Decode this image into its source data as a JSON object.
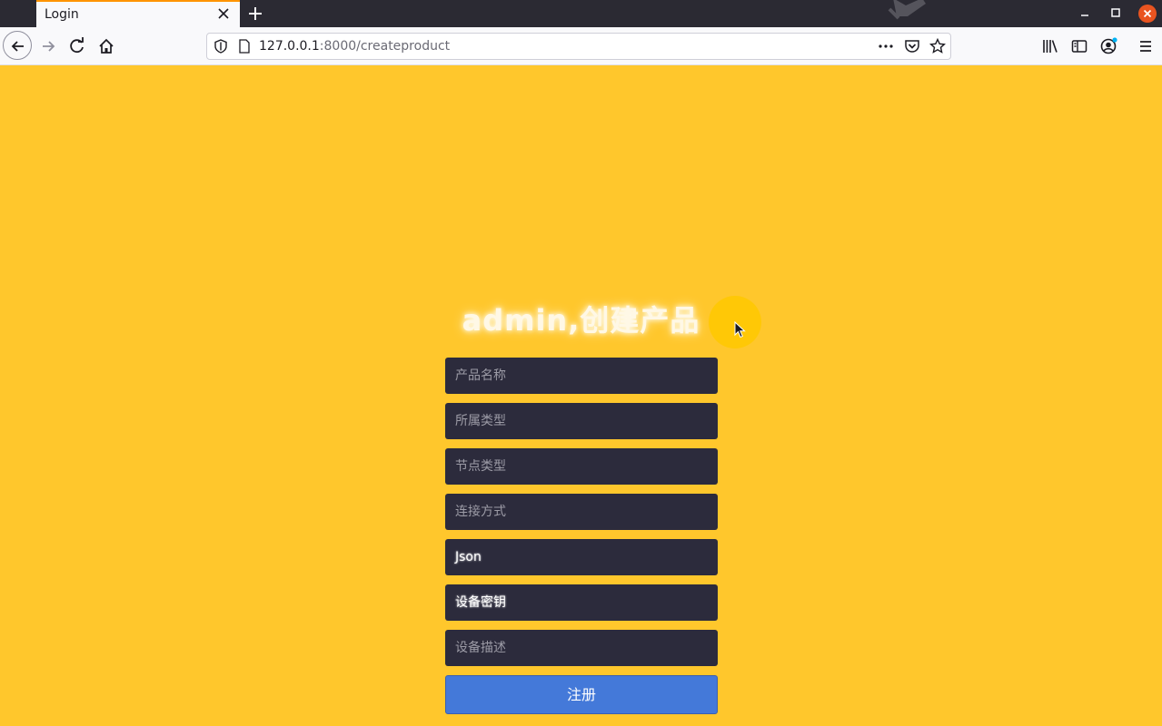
{
  "browser": {
    "tab_title": "Login",
    "url_host": "127.0.0.1",
    "url_path": ":8000/createproduct"
  },
  "page": {
    "heading": "admin,创建产品",
    "fields": [
      {
        "placeholder": "产品名称",
        "value": ""
      },
      {
        "placeholder": "所属类型",
        "value": ""
      },
      {
        "placeholder": "节点类型",
        "value": ""
      },
      {
        "placeholder": "连接方式",
        "value": ""
      },
      {
        "placeholder": "",
        "value": "Json"
      },
      {
        "placeholder": "",
        "value": "设备密钥"
      },
      {
        "placeholder": "设备描述",
        "value": ""
      }
    ],
    "submit_label": "注册"
  },
  "colors": {
    "page_background": "#ffc72c",
    "field_background": "#2c2b3c",
    "submit_background": "#4479d9",
    "tab_accent": "#ff9400"
  },
  "icons": [
    "close-icon",
    "plus-icon",
    "back-arrow-icon",
    "forward-arrow-icon",
    "reload-icon",
    "home-icon",
    "shield-icon",
    "page-icon",
    "more-icon",
    "pocket-icon",
    "star-icon",
    "library-icon",
    "sidebar-icon",
    "account-icon",
    "menu-icon",
    "cursor-icon"
  ]
}
